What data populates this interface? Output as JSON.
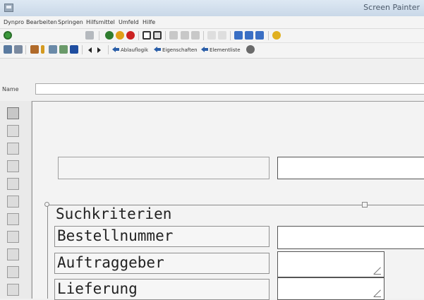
{
  "window": {
    "title": "Screen Painter"
  },
  "menu": [
    "Dynpro",
    "Bearbeiten",
    "Springen",
    "Hilfsmittel",
    "Umfeld",
    "Hilfe"
  ],
  "toolbar2": {
    "ablauflogik": "Ablauflogik",
    "eigenschaften": "Eigenschaften",
    "elementliste": "Elementliste"
  },
  "namebar": {
    "label": "Name",
    "value": ""
  },
  "screen": {
    "frame_title": "Suchkriterien",
    "fields": [
      {
        "label": "Bestellnummer",
        "value": ""
      },
      {
        "label": "Auftraggeber",
        "value": ""
      },
      {
        "label": "Lieferung",
        "value": ""
      }
    ]
  },
  "colors": {
    "titlebar": "#c9d8e8",
    "arrow": "#2a5ea8",
    "canvas": "#f3f3f3"
  }
}
